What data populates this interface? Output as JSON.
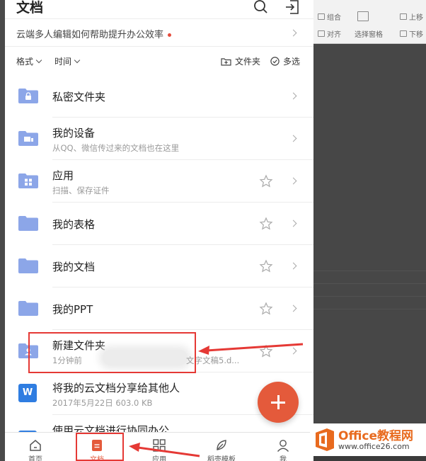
{
  "header": {
    "title": "文档",
    "search_icon": "search-icon",
    "import_icon": "import-icon"
  },
  "notice": {
    "text": "云端多人编辑如何帮助提升办公效率"
  },
  "toolbar": {
    "format_label": "格式",
    "time_label": "时间",
    "new_folder_label": "文件夹",
    "multi_select_label": "多选"
  },
  "list": {
    "items": [
      {
        "name": "私密文件夹",
        "sub": "",
        "icon": "lock-folder-icon",
        "star": false
      },
      {
        "name": "我的设备",
        "sub": "从QQ、微信传过来的文档也在这里",
        "icon": "device-folder-icon",
        "star": false
      },
      {
        "name": "应用",
        "sub": "扫描、保存证件",
        "icon": "app-folder-icon",
        "star": true
      },
      {
        "name": "我的表格",
        "sub": "",
        "icon": "folder-icon",
        "star": true
      },
      {
        "name": "我的文档",
        "sub": "",
        "icon": "folder-icon",
        "star": true
      },
      {
        "name": "我的PPT",
        "sub": "",
        "icon": "folder-icon",
        "star": true
      },
      {
        "name": "新建文件夹",
        "sub": "1分钟前",
        "sub_tail": "文字文稿5.d...",
        "icon": "shared-folder-icon",
        "star": true
      },
      {
        "name": "将我的云文档分享给其他人",
        "sub": "2017年5月22日   603.0 KB",
        "icon": "word-doc-icon",
        "icon_letter": "W",
        "star": false
      },
      {
        "name": "使用云文档进行协同办公",
        "sub": "",
        "icon": "doc-icon",
        "star": false
      }
    ]
  },
  "bottom_nav": {
    "items": [
      {
        "label": "首页",
        "icon": "home-icon"
      },
      {
        "label": "文档",
        "icon": "document-icon",
        "active": true
      },
      {
        "label": "应用",
        "icon": "apps-grid-icon"
      },
      {
        "label": "稻壳模板",
        "icon": "leaf-icon"
      },
      {
        "label": "我",
        "icon": "person-icon"
      }
    ]
  },
  "background_ribbon": {
    "group_label": "组合",
    "align_label": "对齐",
    "select_pane_label": "选择窗格",
    "up_label": "上移",
    "down_label": "下移"
  },
  "watermark": {
    "title": "Office教程网",
    "url": "www.office26.com"
  },
  "colors": {
    "accent": "#e45a3b",
    "folder": "#8ca6e8",
    "annotation": "#e53935"
  }
}
